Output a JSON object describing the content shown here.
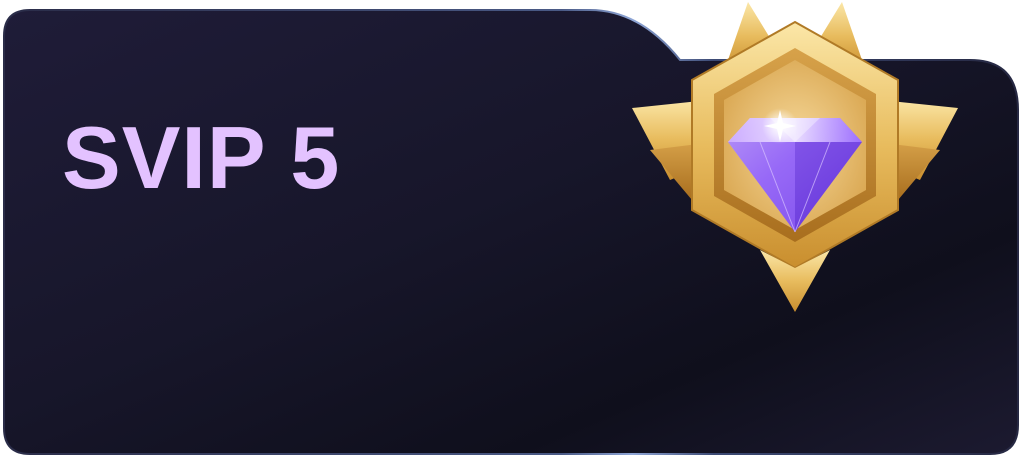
{
  "card": {
    "tier_label": "SVIP 5",
    "badge_icon": "diamond-badge-icon"
  },
  "colors": {
    "title_text": "#E3C2FF",
    "card_bg_dark": "#14131F",
    "card_bg_mid": "#1C1A30",
    "card_border": "#6E7FA8",
    "badge_gold": "#E8BC5E",
    "badge_gold_light": "#FBE7A8",
    "diamond_purple": "#9B6BFF"
  }
}
